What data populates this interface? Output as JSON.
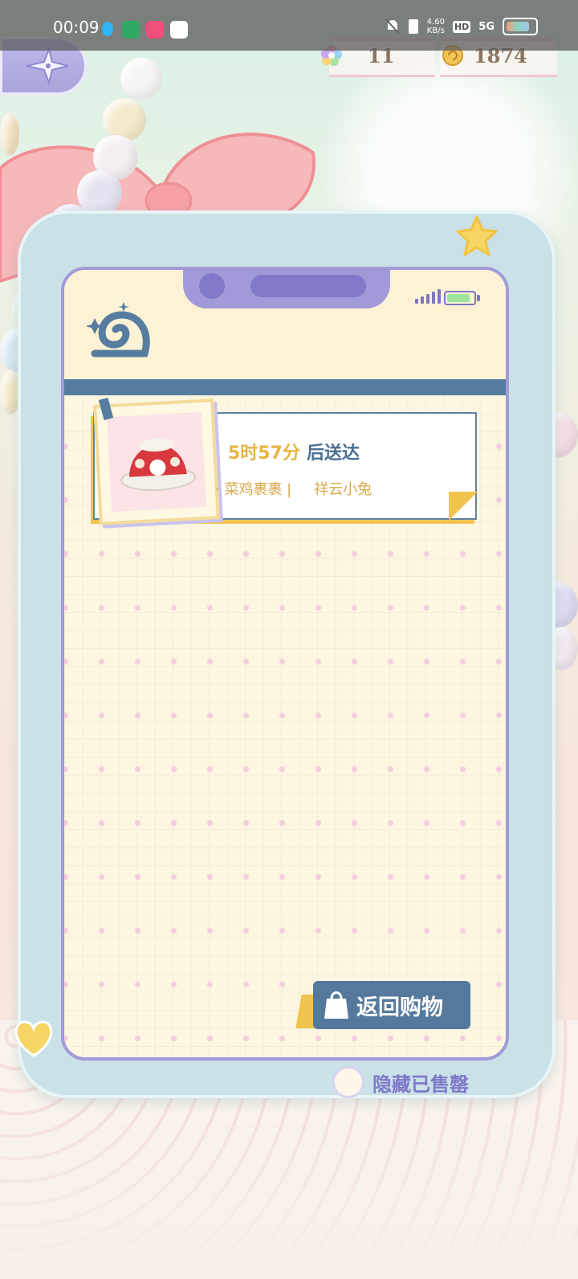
{
  "status_bar": {
    "time": "00:09",
    "network_speed": "4.60\nKB/s",
    "hd": "HD",
    "signal": "5G"
  },
  "resources": {
    "gems": "11",
    "coins": "1874"
  },
  "order": {
    "eta_time": "5时57分",
    "eta_suffix": "后送达",
    "items": [
      "· 菜鸡裹裹 |",
      "祥云小兔"
    ]
  },
  "actions": {
    "return_shopping": "返回购物",
    "hide_sold_out": "隐藏已售罄"
  },
  "icons": {
    "back": "compass-star-icon",
    "gem": "flower-gem-icon",
    "coin": "coin-icon",
    "logo": "snail-spiral-icon",
    "bag": "shopping-bag-icon"
  },
  "colors": {
    "accent_blue": "#55799c",
    "accent_gold": "#e7b443",
    "frame_purple": "#a29ad8"
  }
}
